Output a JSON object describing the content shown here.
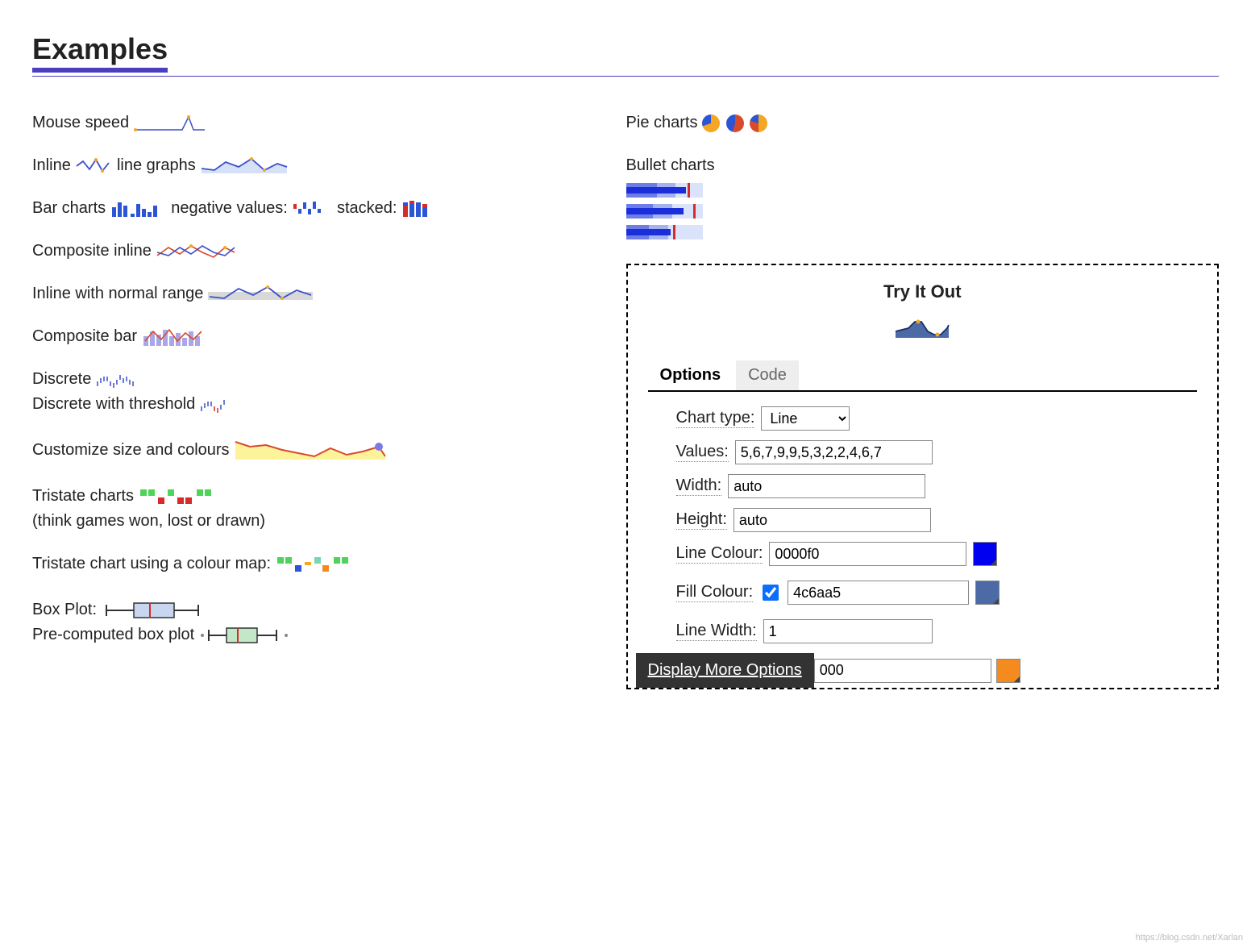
{
  "header": {
    "title": "Examples"
  },
  "left": {
    "mouse_speed": "Mouse speed",
    "inline1": "Inline",
    "inline2": "line graphs",
    "bar1": "Bar charts",
    "bar_neg": "negative values:",
    "bar_stacked": "stacked:",
    "composite_inline": "Composite inline",
    "inline_normal": "Inline with normal range",
    "composite_bar": "Composite bar",
    "discrete": "Discrete",
    "discrete_thresh": "Discrete with threshold",
    "customize": "Customize size and colours",
    "tristate": "Tristate charts",
    "tristate_hint": "(think games won, lost or drawn)",
    "tristate_colormap": "Tristate chart using a colour map:",
    "boxplot": "Box Plot:",
    "pre_box": "Pre-computed box plot"
  },
  "right": {
    "pie_label": "Pie charts",
    "bullet_label": "Bullet charts"
  },
  "tryit": {
    "title": "Try It Out",
    "tabs": {
      "options": "Options",
      "code": "Code"
    },
    "form": {
      "chart_type_label": "Chart type:",
      "chart_type_value": "Line",
      "values_label": "Values:",
      "values_value": "5,6,7,9,9,5,3,2,2,4,6,7",
      "width_label": "Width:",
      "width_value": "auto",
      "height_label": "Height:",
      "height_value": "auto",
      "line_colour_label": "Line Colour:",
      "line_colour_value": "0000f0",
      "line_colour_hex": "#0000f0",
      "fill_colour_label": "Fill Colour:",
      "fill_colour_checked": true,
      "fill_colour_value": "4c6aa5",
      "fill_colour_hex": "#4c6aa5",
      "line_width_label": "Line Width:",
      "line_width_value": "1",
      "display_more": "Display More Options",
      "partial_value": "000",
      "partial_swatch_hex": "#f58a1f"
    }
  },
  "chart_data": [
    {
      "type": "line",
      "name": "mouse_speed",
      "values": [
        0,
        0,
        0,
        0,
        0,
        0,
        0,
        8,
        2,
        0
      ]
    },
    {
      "type": "line",
      "name": "inline_line_a",
      "values": [
        5,
        6,
        3,
        9,
        2,
        8,
        4
      ]
    },
    {
      "type": "line",
      "name": "inline_line_b_filled",
      "values": [
        4,
        6,
        7,
        5,
        9,
        3,
        8,
        6
      ],
      "fill": "#c9d8f3"
    },
    {
      "type": "bar",
      "name": "bar_pos",
      "values": [
        4,
        7,
        5,
        9,
        2,
        5,
        3,
        8,
        6
      ]
    },
    {
      "type": "bar",
      "name": "bar_neg",
      "values": [
        2,
        -3,
        4,
        -2,
        3,
        -4,
        2
      ]
    },
    {
      "type": "bar",
      "name": "bar_stacked",
      "series": [
        {
          "name": "a",
          "values": [
            3,
            5,
            4,
            6
          ]
        },
        {
          "name": "b",
          "values": [
            2,
            3,
            2,
            4
          ]
        }
      ]
    },
    {
      "type": "line",
      "name": "composite_inline",
      "series": [
        {
          "name": "red",
          "values": [
            4,
            7,
            5,
            9,
            6,
            3,
            8,
            5
          ]
        },
        {
          "name": "blue",
          "values": [
            3,
            5,
            7,
            4,
            8,
            6,
            5,
            9
          ]
        }
      ]
    },
    {
      "type": "line",
      "name": "normal_range",
      "values": [
        5,
        7,
        8,
        6,
        9,
        7,
        6,
        8
      ],
      "normal_band": true
    },
    {
      "type": "bar",
      "name": "composite_bar",
      "values": [
        4,
        7,
        6,
        9,
        5,
        8,
        4,
        7,
        5
      ],
      "overlay_line": [
        3,
        8,
        4,
        9,
        3,
        7,
        5,
        6,
        8
      ]
    },
    {
      "type": "line",
      "name": "discrete",
      "values": [
        4,
        6,
        7,
        7,
        4,
        3,
        2,
        1,
        4,
        5,
        6,
        7,
        6,
        5,
        3,
        2
      ]
    },
    {
      "type": "line",
      "name": "discrete_threshold",
      "values": [
        4,
        6,
        7,
        7,
        4,
        3,
        2,
        1,
        4
      ],
      "threshold": 5
    },
    {
      "type": "line",
      "name": "custom_size",
      "values": [
        9,
        7,
        8,
        6,
        5,
        4,
        3,
        6,
        4,
        5,
        7,
        4,
        3
      ]
    },
    {
      "type": "bar",
      "name": "tristate",
      "values": [
        1,
        1,
        -1,
        1,
        -1,
        -1,
        1,
        1
      ]
    },
    {
      "type": "bar",
      "name": "tristate_colormap",
      "values": [
        1,
        1,
        -1,
        0,
        1,
        -1,
        1,
        1
      ]
    },
    {
      "type": "table",
      "name": "boxplot",
      "values": {
        "lw": 10,
        "q1": 25,
        "med": 40,
        "q3": 60,
        "uw": 90
      }
    },
    {
      "type": "table",
      "name": "pre_boxplot",
      "values": {
        "lw": 15,
        "q1": 30,
        "med": 45,
        "q3": 55,
        "uw": 80
      }
    },
    {
      "type": "pie",
      "name": "pie1",
      "values": [
        70,
        30
      ],
      "colors": [
        "#f5a623",
        "#2b55d4"
      ]
    },
    {
      "type": "pie",
      "name": "pie2",
      "values": [
        55,
        45
      ],
      "colors": [
        "#d94a2b",
        "#2b55d4"
      ]
    },
    {
      "type": "pie",
      "name": "pie3",
      "values": [
        50,
        30,
        20
      ],
      "colors": [
        "#f5a623",
        "#d94a2b",
        "#2b55d4"
      ]
    },
    {
      "type": "table",
      "name": "bullet1",
      "values": {
        "range_dark": 40,
        "range_mid": 65,
        "measure": 78,
        "target": 80
      }
    },
    {
      "type": "table",
      "name": "bullet2",
      "values": {
        "range_dark": 35,
        "range_mid": 60,
        "measure": 75,
        "target": 88
      }
    },
    {
      "type": "table",
      "name": "bullet3",
      "values": {
        "range_dark": 30,
        "range_mid": 55,
        "measure": 58,
        "target": 62
      }
    },
    {
      "type": "area",
      "name": "tryit_preview",
      "values": [
        5,
        6,
        7,
        9,
        9,
        5,
        3,
        2,
        2,
        4,
        6,
        7
      ],
      "line": "#2d4a8a",
      "fill": "#4c6aa5"
    }
  ],
  "watermark": "https://blog.csdn.net/Xarlan"
}
